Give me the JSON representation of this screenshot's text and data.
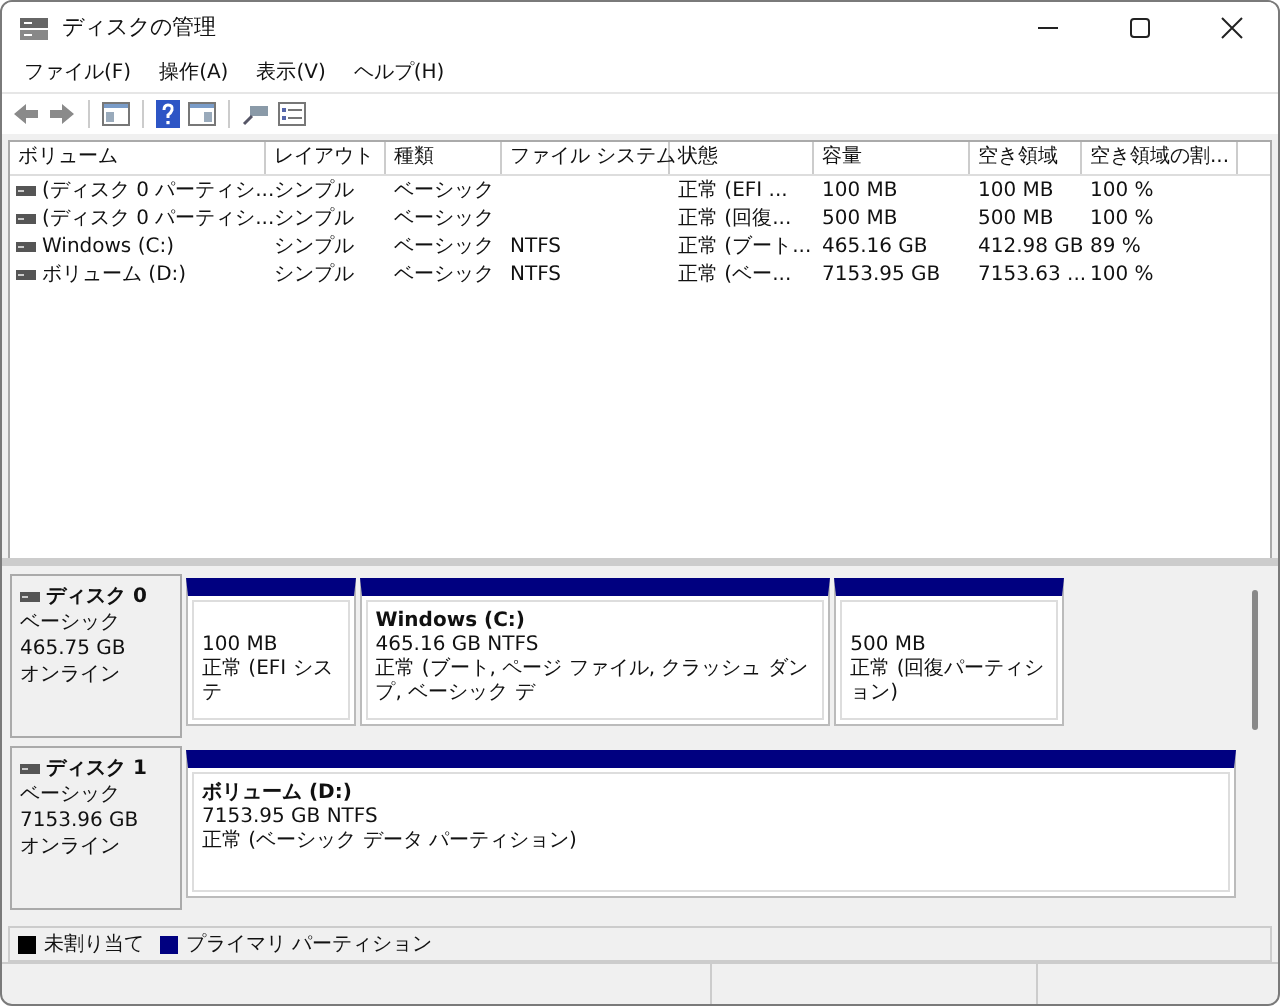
{
  "window": {
    "title": "ディスクの管理"
  },
  "menu": [
    "ファイル(F)",
    "操作(A)",
    "表示(V)",
    "ヘルプ(H)"
  ],
  "volume_list": {
    "columns": [
      "ボリューム",
      "レイアウト",
      "種類",
      "ファイル システム",
      "状態",
      "容量",
      "空き領域",
      "空き領域の割..."
    ],
    "rows": [
      {
        "cells": [
          "(ディスク 0 パーティシ...",
          "シンプル",
          "ベーシック",
          "",
          "正常 (EFI ...",
          "100 MB",
          "100 MB",
          "100 %"
        ]
      },
      {
        "cells": [
          "(ディスク 0 パーティシ...",
          "シンプル",
          "ベーシック",
          "",
          "正常 (回復...",
          "500 MB",
          "500 MB",
          "100 %"
        ]
      },
      {
        "cells": [
          "Windows (C:)",
          "シンプル",
          "ベーシック",
          "NTFS",
          "正常 (ブート...",
          "465.16 GB",
          "412.98 GB",
          "89 %"
        ]
      },
      {
        "cells": [
          "ボリューム (D:)",
          "シンプル",
          "ベーシック",
          "NTFS",
          "正常 (ベー...",
          "7153.95 GB",
          "7153.63 ...",
          "100 %"
        ]
      }
    ]
  },
  "disks": [
    {
      "name": "ディスク 0",
      "type": "ベーシック",
      "size": "465.75 GB",
      "status": "オンライン",
      "partitions": [
        {
          "kind": "primary",
          "size": "100 MB",
          "status": "正常 (EFI システ"
        },
        {
          "kind": "primary",
          "name": "Windows  (C:)",
          "size": "465.16 GB NTFS",
          "status": "正常 (ブート, ページ ファイル, クラッシュ ダンプ, ベーシック デ"
        },
        {
          "kind": "primary",
          "size": "500 MB",
          "status": "正常 (回復パーティション)"
        }
      ]
    },
    {
      "name": "ディスク 1",
      "type": "ベーシック",
      "size": "7153.96 GB",
      "status": "オンライン",
      "partitions": [
        {
          "kind": "primary",
          "name": "ボリューム  (D:)",
          "size": "7153.95 GB NTFS",
          "status": "正常 (ベーシック データ パーティション)"
        }
      ]
    }
  ],
  "legend": [
    {
      "label": "未割り当て",
      "color": "#000000"
    },
    {
      "label": "プライマリ パーティション",
      "color": "#000080"
    }
  ]
}
